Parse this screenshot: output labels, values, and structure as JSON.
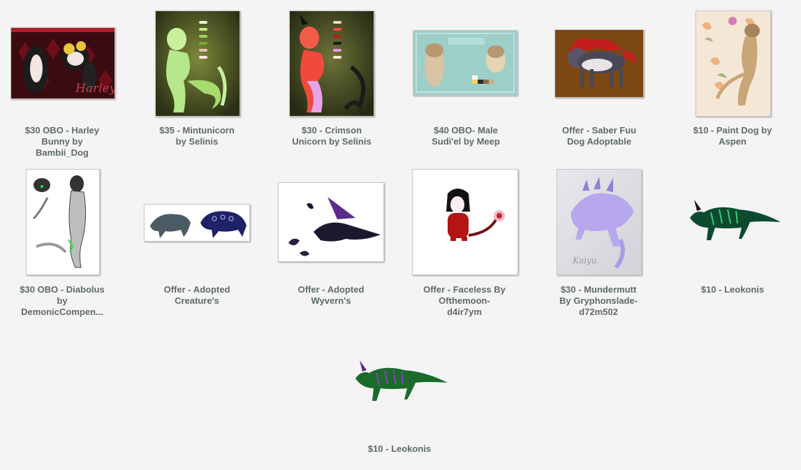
{
  "items": [
    {
      "lines": [
        "$30 OBO - Harley",
        "Bunny by",
        "Bambii_Dog"
      ],
      "thumb_text": "Harley"
    },
    {
      "lines": [
        "$35 - Mintunicorn",
        "by Selinis"
      ]
    },
    {
      "lines": [
        "$30 - Crimson",
        "Unicorn by Selinis"
      ]
    },
    {
      "lines": [
        "$40 OBO- Male",
        "Sudi'el by Meep"
      ]
    },
    {
      "lines": [
        "Offer - Saber Fuu",
        "Dog Adoptable"
      ]
    },
    {
      "lines": [
        "$10 - Paint Dog by",
        "Aspen"
      ]
    },
    {
      "lines": [
        "$30 OBO - Diabolus",
        "by",
        "DemonicCompen..."
      ]
    },
    {
      "lines": [
        "Offer - Adopted",
        "Creature's"
      ]
    },
    {
      "lines": [
        "Offer - Adopted",
        "Wyvern's"
      ]
    },
    {
      "lines": [
        "Offer - Faceless By",
        "Ofthemoon-",
        "d4ir7ym"
      ]
    },
    {
      "lines": [
        "$30 - Mundermutt",
        "By Gryphonslade-",
        "d72m502"
      ]
    },
    {
      "lines": [
        "$10 - Leokonis"
      ]
    },
    {
      "lines": [
        "$10 - Leokonis"
      ]
    }
  ]
}
